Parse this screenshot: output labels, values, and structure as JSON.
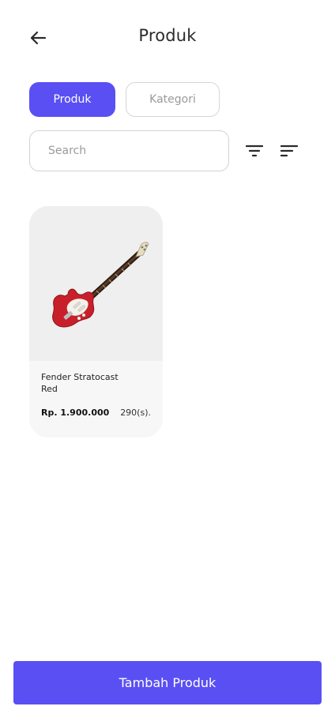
{
  "header": {
    "title": "Produk",
    "back_icon": "arrow-left-icon"
  },
  "tabs": [
    {
      "label": "Produk",
      "active": true
    },
    {
      "label": "Kategori",
      "active": false
    }
  ],
  "search": {
    "placeholder": "Search",
    "value": ""
  },
  "toolbar": {
    "filter_icon": "filter-icon",
    "sort_icon": "sort-icon"
  },
  "products": [
    {
      "name": "Fender Stratocast Red",
      "price": "Rp. 1.900.000",
      "stock": "290(s).",
      "image_icon": "electric-guitar-image"
    }
  ],
  "footer": {
    "add_button_label": "Tambah Produk"
  },
  "colors": {
    "accent": "#5a4ff3",
    "guitar_body": "#c8202a"
  }
}
